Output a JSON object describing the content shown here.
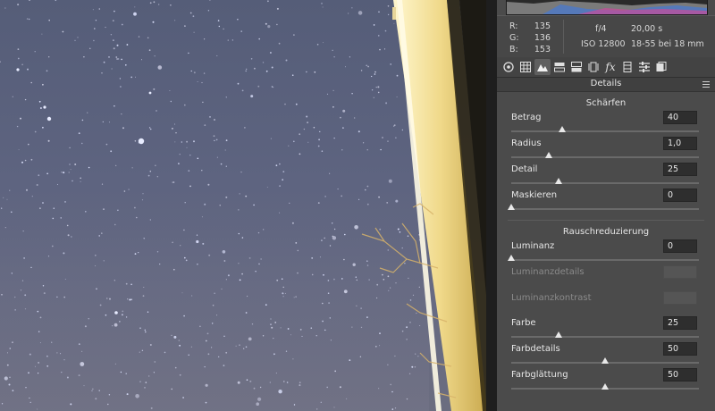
{
  "info": {
    "rgb": [
      {
        "label": "R:",
        "value": "135"
      },
      {
        "label": "G:",
        "value": "136"
      },
      {
        "label": "B:",
        "value": "153"
      }
    ],
    "aperture": "f/4",
    "shutter": "20,00 s",
    "iso": "ISO 12800",
    "lens": "18-55 bei 18 mm"
  },
  "toolbar": {
    "icons": [
      "aperture-icon",
      "grid-icon",
      "mountain-icon",
      "split-toning-icon",
      "lens-correction-icon",
      "transform-icon",
      "fx-icon",
      "camera-calibration-icon",
      "presets-icon",
      "snapshots-icon"
    ],
    "active_index": 2
  },
  "panel": {
    "title": "Details",
    "sharpening": {
      "title": "Schärfen",
      "controls": [
        {
          "label": "Betrag",
          "value": "40",
          "slider": 0.27
        },
        {
          "label": "Radius",
          "value": "1,0",
          "slider": 0.2
        },
        {
          "label": "Detail",
          "value": "25",
          "slider": 0.25
        },
        {
          "label": "Maskieren",
          "value": "0",
          "slider": 0.0
        }
      ]
    },
    "noise": {
      "title": "Rauschreduzierung",
      "controls": [
        {
          "label": "Luminanz",
          "value": "0",
          "slider": 0.0,
          "enabled": true
        },
        {
          "label": "Luminanzdetails",
          "value": "",
          "enabled": false
        },
        {
          "label": "Luminanzkontrast",
          "value": "",
          "enabled": false
        },
        {
          "label": "Farbe",
          "value": "25",
          "slider": 0.25,
          "enabled": true
        },
        {
          "label": "Farbdetails",
          "value": "50",
          "slider": 0.5,
          "enabled": true
        },
        {
          "label": "Farbglättung",
          "value": "50",
          "slider": 0.5,
          "enabled": true
        }
      ]
    }
  },
  "colors": {
    "panel_bg": "#4b4b4b",
    "sky": "#5e6480",
    "window_frame": "#f5e6a8"
  }
}
